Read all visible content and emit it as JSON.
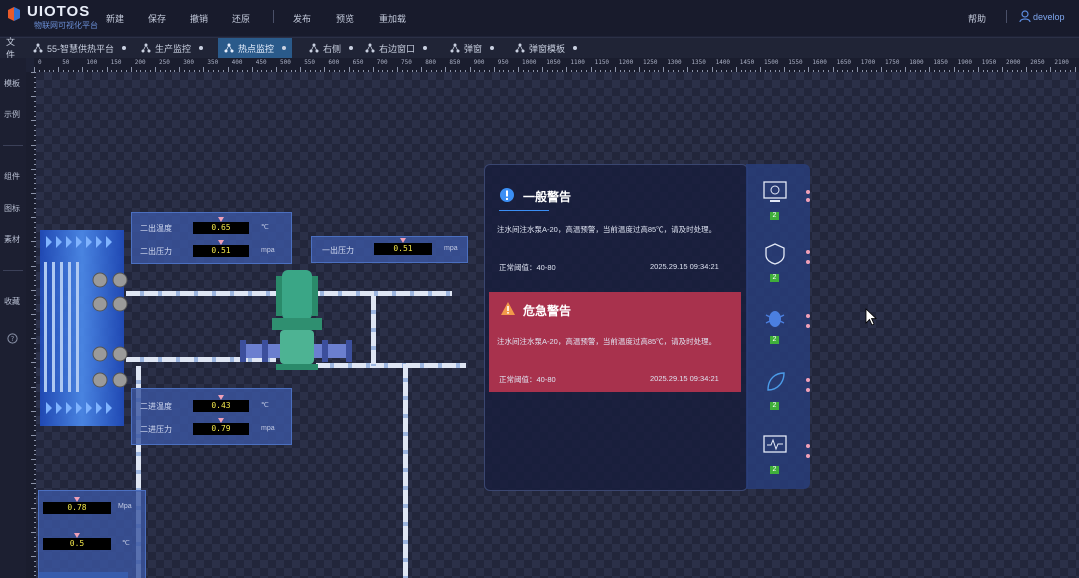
{
  "app": {
    "logo_name": "UIOTOS",
    "logo_sub": "物联网可视化平台"
  },
  "toolbar": {
    "items": [
      "新建",
      "保存",
      "撤销",
      "还原",
      "发布",
      "预览",
      "重加载"
    ],
    "help": "帮助",
    "user": "develop"
  },
  "tabs": [
    {
      "label": "文件"
    },
    {
      "label": "55-智慧供热平台"
    },
    {
      "label": "生产监控"
    },
    {
      "label": "热点监控",
      "active": true
    },
    {
      "label": "右侧"
    },
    {
      "label": "右边窗口"
    },
    {
      "label": "弹窗"
    },
    {
      "label": "弹窗模板"
    }
  ],
  "sidebar": {
    "items": [
      "模板",
      "示例",
      "组件",
      "图标",
      "素材",
      "收藏"
    ]
  },
  "ruler": {
    "labels": [
      "0",
      "50",
      "100",
      "150",
      "200",
      "250",
      "300",
      "350",
      "400",
      "450",
      "500",
      "550",
      "600",
      "650",
      "700",
      "750",
      "800",
      "850",
      "900",
      "950",
      "1000",
      "1050",
      "1100",
      "1150",
      "1200",
      "1250",
      "1300",
      "1350",
      "1400",
      "1450",
      "1500",
      "1550",
      "1600",
      "1650",
      "1700",
      "1750",
      "1800",
      "1850",
      "1900",
      "1950",
      "2000",
      "2050",
      "2100"
    ]
  },
  "plant": {
    "sec_out": {
      "temp_label": "二出温度",
      "temp_value": "0.65",
      "temp_unit": "℃",
      "press_label": "二出压力",
      "press_value": "0.51",
      "press_unit": "mpa"
    },
    "pri_out": {
      "press_label": "一出压力",
      "press_value": "0.51",
      "press_unit": "mpa"
    },
    "sec_in": {
      "temp_label": "二进温度",
      "temp_value": "0.43",
      "temp_unit": "℃",
      "press_label": "二进压力",
      "press_value": "0.79",
      "press_unit": "mpa"
    },
    "bottom": {
      "v1": "0.78",
      "u1": "Mpa",
      "v2": "0.5",
      "u2": "℃"
    }
  },
  "alerts": {
    "general": {
      "title": "一般警告",
      "text": "注水间注水泵A-20，高温预警，当前温度过高85℃，请及时处理。",
      "threshold": "正常阈值：40-80",
      "time": "2025.29.15  09:34:21"
    },
    "danger": {
      "title": "危急警告",
      "text": "注水间注水泵A-20，高温预警，当前温度过高85℃，请及时处理。",
      "threshold": "正常阈值：40-80",
      "time": "2025.29.15  09:34:21"
    }
  },
  "icon_stack": {
    "badges": [
      "2",
      "2",
      "2",
      "2",
      "2"
    ]
  },
  "colors": {
    "topbar": "#181b2c",
    "active_tab": "#2a5a8a",
    "panel": "#3a56a0",
    "value_text": "#f3e84b",
    "danger": "#c83750",
    "accent": "#2f7be0"
  }
}
